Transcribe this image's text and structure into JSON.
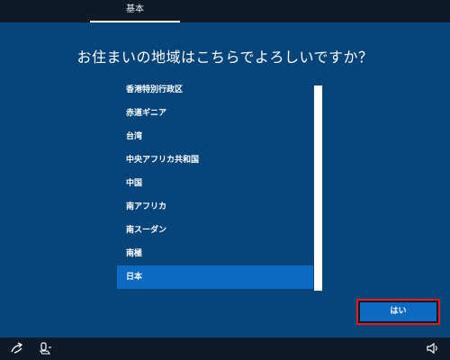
{
  "top_tab": {
    "label": "基本"
  },
  "question": "お住まいの地域はこちらでよろしいですか？",
  "region_list": {
    "items": [
      "香港特別行政区",
      "赤道ギニア",
      "台湾",
      "中央アフリカ共和国",
      "中国",
      "南アフリカ",
      "南スーダン",
      "南極",
      "日本"
    ],
    "selected": "日本"
  },
  "yes_button": {
    "label": "はい"
  },
  "icons": {
    "accessibility": "ease-of-access-icon",
    "network": "microphone-icon",
    "volume": "speaker-volume-icon"
  },
  "colors": {
    "panel": "#07447a",
    "selection": "#0d6ac2",
    "chrome": "#0e1a28",
    "highlight_border": "#e8191c"
  }
}
